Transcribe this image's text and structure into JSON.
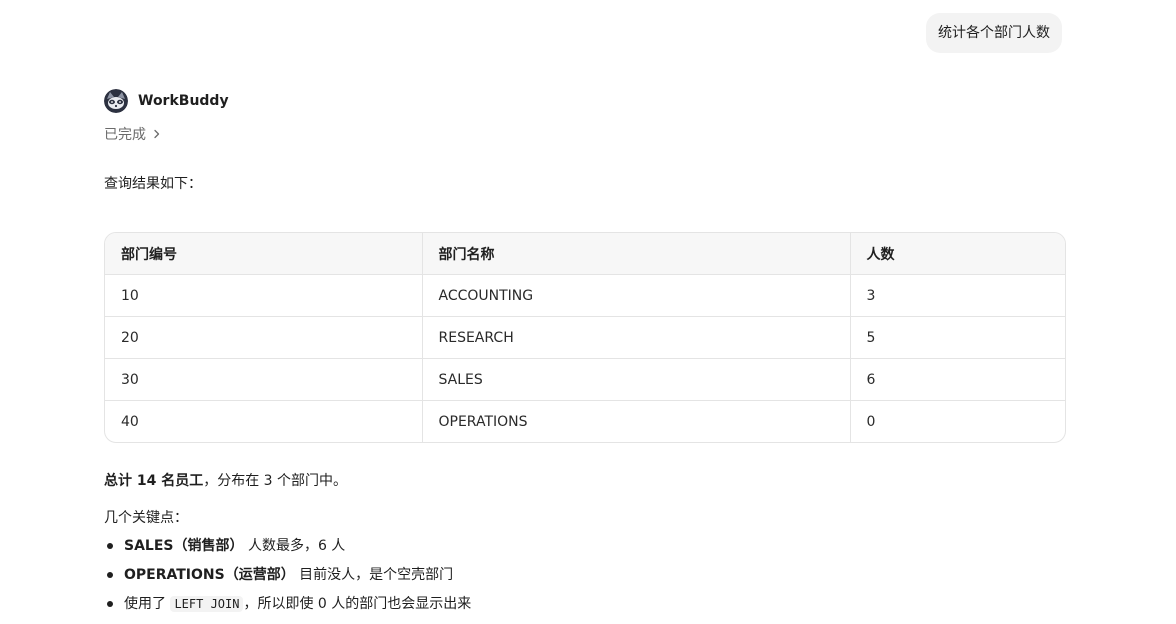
{
  "user_message": "统计各个部门人数",
  "agent": {
    "name": "WorkBuddy",
    "avatar_icon": "raccoon-avatar-icon"
  },
  "status": {
    "label": "已完成",
    "icon": "chevron-right-icon"
  },
  "intro": "查询结果如下：",
  "table": {
    "headers": [
      "部门编号",
      "部门名称",
      "人数"
    ],
    "rows": [
      [
        "10",
        "ACCOUNTING",
        "3"
      ],
      [
        "20",
        "RESEARCH",
        "5"
      ],
      [
        "30",
        "SALES",
        "6"
      ],
      [
        "40",
        "OPERATIONS",
        "0"
      ]
    ]
  },
  "summary": {
    "bold": "总计 14 名员工",
    "rest": "，分布在 3 个部门中。"
  },
  "keypoints": {
    "title": "几个关键点：",
    "items": [
      {
        "bold": "SALES（销售部）",
        "text": " 人数最多，6 人"
      },
      {
        "bold": "OPERATIONS（运营部）",
        "text": " 目前没人，是个空壳部门"
      },
      {
        "prefix": "使用了 ",
        "code": "LEFT JOIN",
        "suffix": "，所以即使 0 人的部门也会显示出来"
      }
    ]
  }
}
